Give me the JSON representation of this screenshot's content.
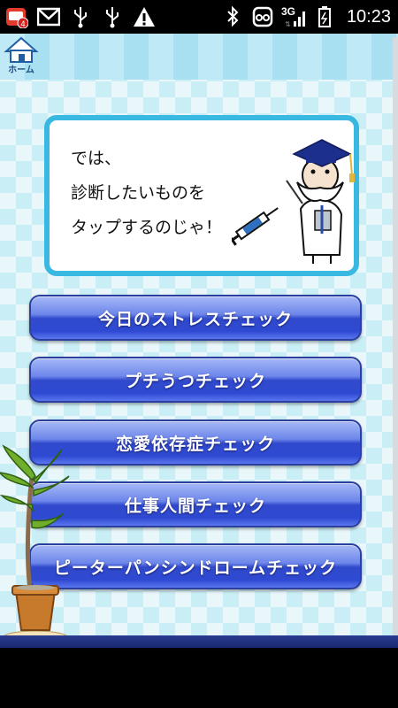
{
  "status_bar": {
    "time": "10:23",
    "network": "3G",
    "notification_count": "4",
    "icons": [
      "app-notification-icon",
      "gmail-icon",
      "usb-icon",
      "usb-icon",
      "warning-icon",
      "bluetooth-icon",
      "voicemail-icon",
      "signal-icon",
      "battery-icon"
    ]
  },
  "header": {
    "home_label": "ホーム"
  },
  "speech": {
    "text": "では、\n診断したいものを\nタップするのじゃ！"
  },
  "menu": [
    {
      "label": "今日のストレスチェック"
    },
    {
      "label": "プチうつチェック"
    },
    {
      "label": "恋愛依存症チェック"
    },
    {
      "label": "仕事人間チェック"
    },
    {
      "label": "ピーターパンシンドロームチェック"
    }
  ],
  "colors": {
    "button_blue": "#2f4ad2",
    "frame_cyan": "#39b8e2",
    "check_light": "#e9f6fa",
    "check_dark": "#c9eef5"
  }
}
